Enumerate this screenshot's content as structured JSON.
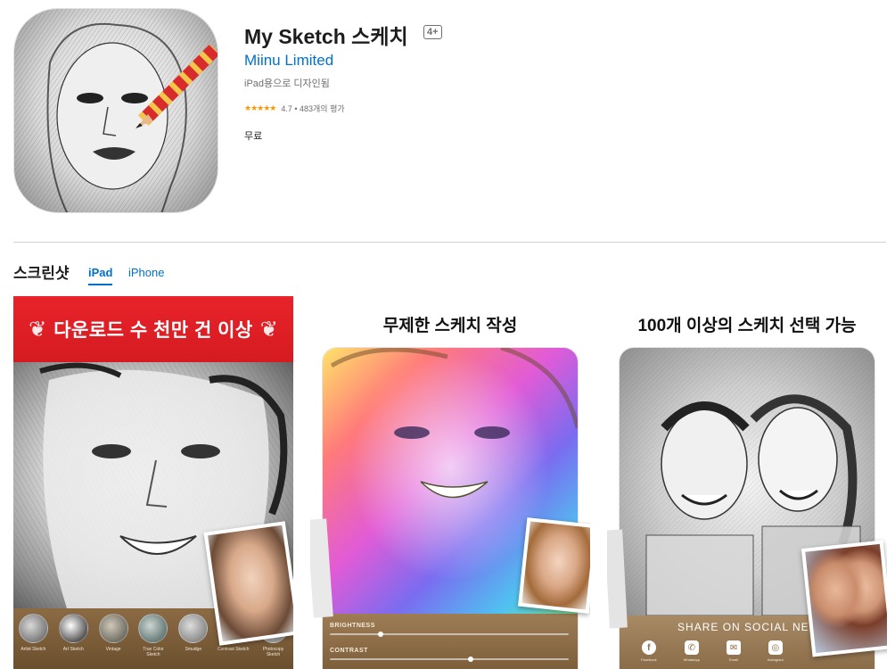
{
  "app": {
    "title": "My Sketch 스케치",
    "age_rating": "4+",
    "developer": "Miinu Limited",
    "designed_for": "iPad용으로 디자인됨",
    "stars": "★★★★★",
    "rating_text": "4.7 • 483개의 평가",
    "price": "무료"
  },
  "screenshots": {
    "title": "스크린샷",
    "tabs": [
      {
        "label": "iPad",
        "active": true
      },
      {
        "label": "iPhone",
        "active": false
      }
    ],
    "items": [
      {
        "banner": "다운로드 수 천만 건 이상",
        "filters": [
          "Artist Sketch",
          "Art Sketch",
          "Vintage",
          "True Color Sketch",
          "Smudge",
          "Contrast Sketch",
          "Photocopy Sketch"
        ]
      },
      {
        "caption": "무제한 스케치 작성",
        "controls": [
          "BRIGHTNESS",
          "CONTRAST"
        ],
        "control_levels": [
          0.2,
          0.58
        ]
      },
      {
        "caption": "100개 이상의 스케치 선택 가능",
        "share_title": "SHARE ON SOCIAL NET",
        "share_targets": [
          "Facebook",
          "WhatsApp",
          "Email",
          "Instagram"
        ]
      }
    ]
  },
  "colors": {
    "link": "#0070c9",
    "star": "#ff9500",
    "banner_red": "#e8232a"
  }
}
